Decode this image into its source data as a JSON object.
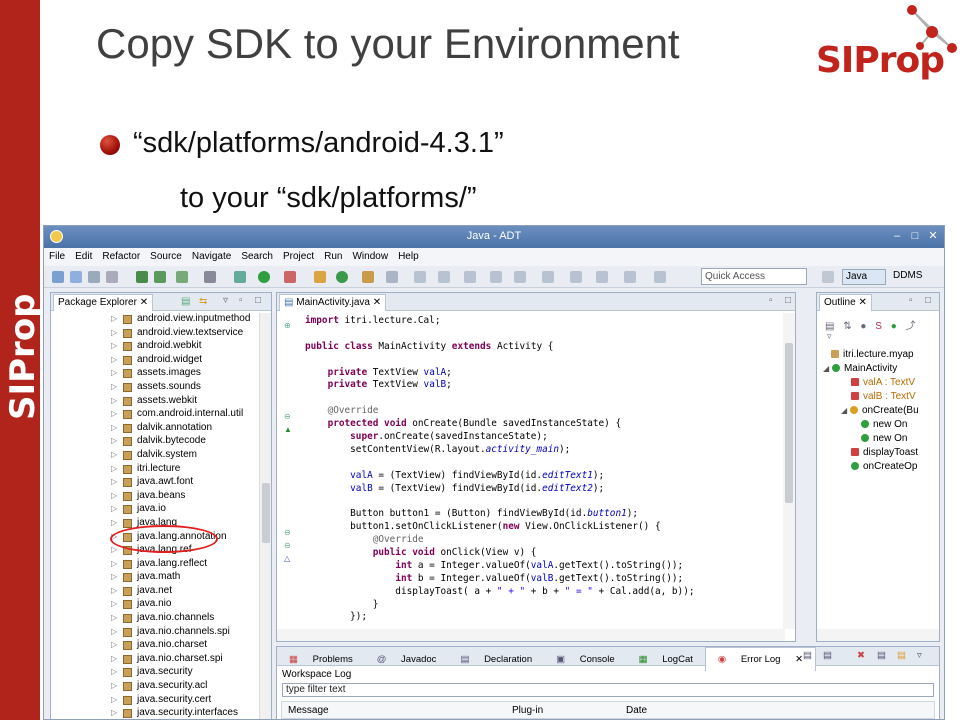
{
  "slide": {
    "title": "Copy SDK to your Environment",
    "brand_vertical": "SIProp",
    "logo_text": "SIProp",
    "bullet_line1": "“sdk/platforms/android-4.3.1”",
    "bullet_line2": "to your “sdk/platforms/”"
  },
  "ide": {
    "window_title": "Java - ADT",
    "menu": [
      "File",
      "Edit",
      "Refactor",
      "Source",
      "Navigate",
      "Search",
      "Project",
      "Run",
      "Window",
      "Help"
    ],
    "quick_access": "Quick Access",
    "perspectives": {
      "java": "Java",
      "ddms": "DDMS"
    },
    "package_explorer": {
      "tab": "Package Explorer",
      "items": [
        "android.view.inputmethod",
        "android.view.textservice",
        "android.webkit",
        "android.widget",
        "assets.images",
        "assets.sounds",
        "assets.webkit",
        "com.android.internal.util",
        "dalvik.annotation",
        "dalvik.bytecode",
        "dalvik.system",
        "itri.lecture",
        "java.awt.font",
        "java.beans",
        "java.io",
        "java.lang",
        "java.lang.annotation",
        "java.lang.ref",
        "java.lang.reflect",
        "java.math",
        "java.net",
        "java.nio",
        "java.nio.channels",
        "java.nio.channels.spi",
        "java.nio.charset",
        "java.nio.charset.spi",
        "java.security",
        "java.security.acl",
        "java.security.cert",
        "java.security.interfaces"
      ]
    },
    "editor": {
      "tab": "MainActivity.java",
      "code": [
        "import itri.lecture.Cal;",
        "",
        "public class MainActivity extends Activity {",
        "",
        "    private TextView valA;",
        "    private TextView valB;",
        "",
        "    @Override",
        "    protected void onCreate(Bundle savedInstanceState) {",
        "        super.onCreate(savedInstanceState);",
        "        setContentView(R.layout.activity_main);",
        "",
        "        valA = (TextView) findViewById(id.editText1);",
        "        valB = (TextView) findViewById(id.editText2);",
        "",
        "        Button button1 = (Button) findViewById(id.button1);",
        "        button1.setOnClickListener(new View.OnClickListener() {",
        "            @Override",
        "            public void onClick(View v) {",
        "                int a = Integer.valueOf(valA.getText().toString());",
        "                int b = Integer.valueOf(valB.getText().toString());",
        "                displayToast( a + \" + \" + b + \" = \" + Cal.add(a, b));",
        "            }",
        "        });"
      ]
    },
    "outline": {
      "tab": "Outline",
      "items": [
        "itri.lecture.myap",
        "MainActivity",
        "valA : TextV",
        "valB : TextV",
        "onCreate(Bu",
        "new On",
        "new On",
        "displayToast",
        "onCreateOp"
      ]
    },
    "bottom": {
      "tabs": [
        "Problems",
        "Javadoc",
        "Declaration",
        "Console",
        "LogCat",
        "Error Log"
      ],
      "workspace_log": "Workspace Log",
      "filter_text": "type filter text",
      "columns": [
        "Message",
        "Plug-in",
        "Date"
      ]
    }
  }
}
